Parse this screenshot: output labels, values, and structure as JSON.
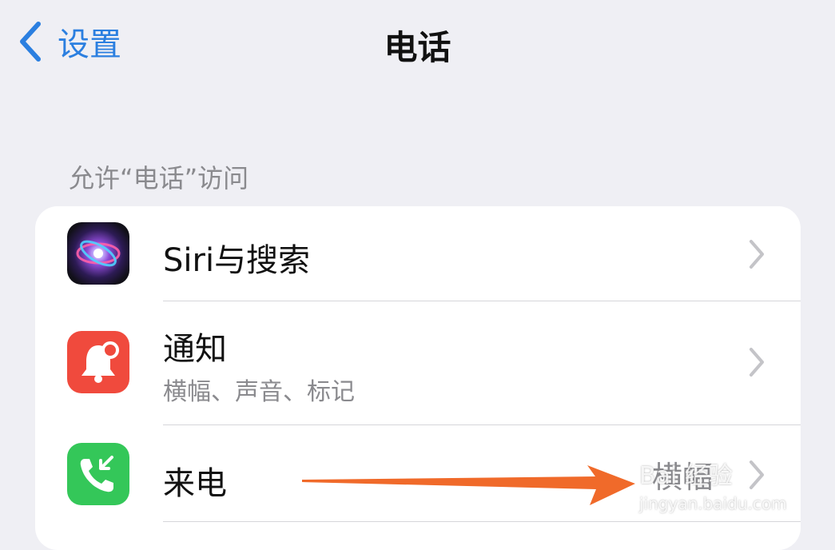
{
  "nav": {
    "back_label": "设置",
    "title": "电话"
  },
  "section": {
    "header": "允许“电话”访问"
  },
  "rows": [
    {
      "title": "Siri与搜索",
      "icon": "siri-icon"
    },
    {
      "title": "通知",
      "subtitle": "横幅、声音、标记",
      "icon": "bell-icon"
    },
    {
      "title": "来电",
      "value": "横幅",
      "icon": "phone-incoming-icon"
    }
  ],
  "watermark": {
    "brand": "Bai 经验",
    "url": "jingyan.baidu.com"
  },
  "colors": {
    "accent": "#2b7fe0",
    "annotation_arrow": "#f06a2a",
    "notification_red": "#f04a3d",
    "phone_green": "#34c759"
  }
}
